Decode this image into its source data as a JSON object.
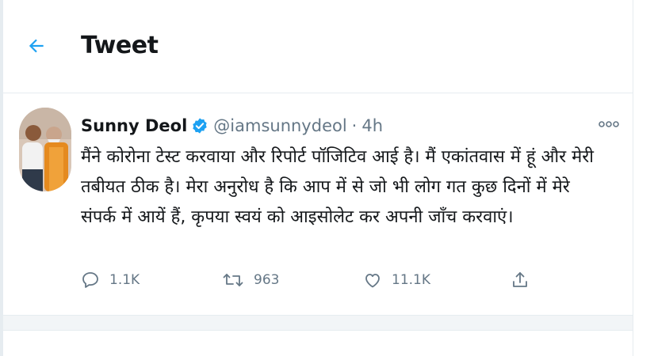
{
  "header": {
    "title": "Tweet",
    "back_icon": "arrow-left-icon"
  },
  "tweet": {
    "author": {
      "name": "Sunny Deol",
      "handle": "@iamsunnydeol",
      "verified": true
    },
    "separator": "·",
    "time": "4h",
    "text": "मैंने कोरोना टेस्ट करवाया और रिपोर्ट पॉजिटिव आई है। मैं एकांतवास में हूं और मेरी तबीयत ठीक है। मेरा अनुरोध है कि आप में से जो भी लोग गत कुछ दिनों में मेरे संपर्क में आयें हैं, कृपया स्वयं को आइसोलेट कर अपनी जाँच करवाएं।",
    "actions": {
      "reply": {
        "icon": "reply-icon",
        "count": "1.1K"
      },
      "retweet": {
        "icon": "retweet-icon",
        "count": "963"
      },
      "like": {
        "icon": "heart-icon",
        "count": "11.1K"
      },
      "share": {
        "icon": "share-icon"
      }
    }
  },
  "colors": {
    "accent": "#1da1f2",
    "text": "#14171a",
    "muted": "#657786",
    "border": "#e6ecf0"
  }
}
